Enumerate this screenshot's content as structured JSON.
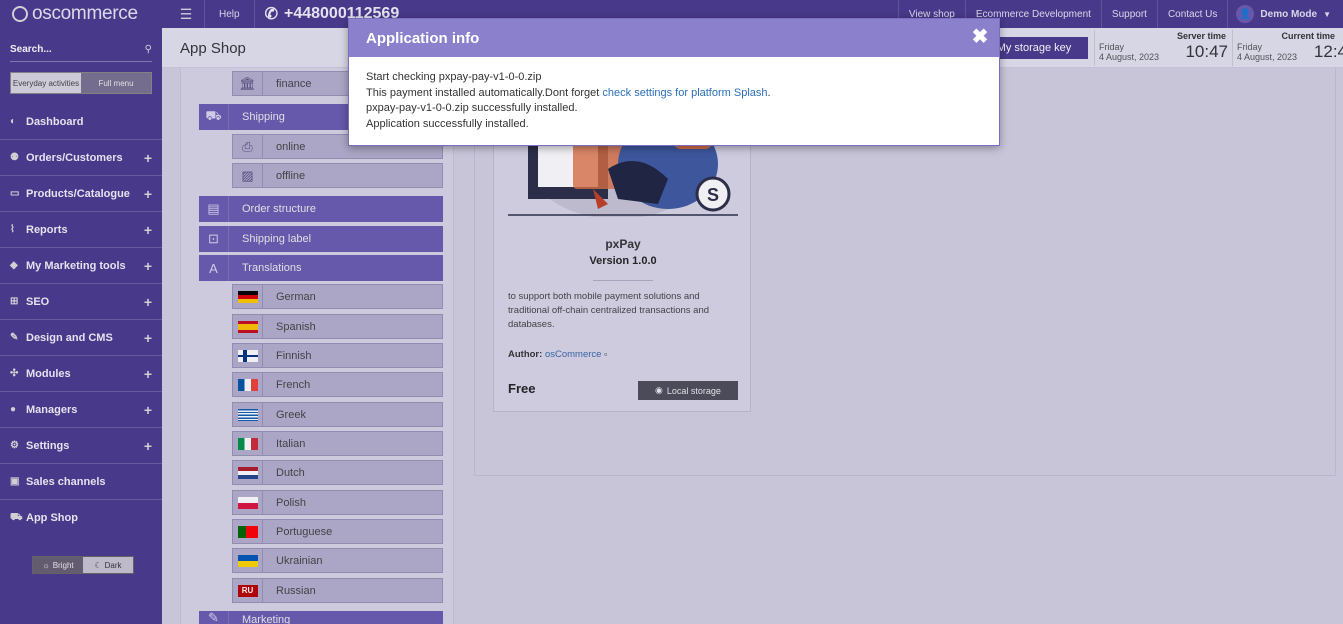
{
  "topbar": {
    "logo": "oscommerce",
    "help": "Help",
    "phone": "+448000112569",
    "links": [
      "View shop",
      "Ecommerce Development",
      "Support",
      "Contact Us"
    ],
    "user": "Demo Mode"
  },
  "sidebar": {
    "search_placeholder": "Search...",
    "toggle": [
      "Everyday activities",
      "Full menu"
    ],
    "items": [
      {
        "label": "Dashboard",
        "icon": "palette-icon",
        "plus": ""
      },
      {
        "label": "Orders/Customers",
        "icon": "users-icon",
        "plus": "+"
      },
      {
        "label": "Products/Catalogue",
        "icon": "folder-icon",
        "plus": "+"
      },
      {
        "label": "Reports",
        "icon": "chart-icon",
        "plus": "+"
      },
      {
        "label": "My Marketing tools",
        "icon": "tag-icon",
        "plus": "+"
      },
      {
        "label": "SEO",
        "icon": "sitemap-icon",
        "plus": "+"
      },
      {
        "label": "Design and CMS",
        "icon": "brush-icon",
        "plus": "+"
      },
      {
        "label": "Modules",
        "icon": "puzzle-icon",
        "plus": "+"
      },
      {
        "label": "Managers",
        "icon": "user-icon",
        "plus": "+"
      },
      {
        "label": "Settings",
        "icon": "gears-icon",
        "plus": "+"
      },
      {
        "label": "Sales channels",
        "icon": "monitor-icon",
        "plus": ""
      },
      {
        "label": "App Shop",
        "icon": "cart-icon",
        "plus": ""
      }
    ],
    "theme": [
      "Bright",
      "Dark"
    ]
  },
  "header": {
    "title": "App Shop",
    "storage_button": "My storage key",
    "server_time": {
      "label": "Server time",
      "day": "Friday",
      "date": "4 August, 2023",
      "time": "10:47"
    },
    "current_time": {
      "label": "Current time",
      "day": "Friday",
      "date": "4 August, 2023",
      "time": "12:4"
    }
  },
  "tree": {
    "finance": "finance",
    "shipping": "Shipping",
    "online": "online",
    "offline": "offline",
    "order_structure": "Order structure",
    "shipping_label": "Shipping label",
    "translations": "Translations",
    "languages": [
      "German",
      "Spanish",
      "Finnish",
      "French",
      "Greek",
      "Italian",
      "Dutch",
      "Polish",
      "Portuguese",
      "Ukrainian",
      "Russian"
    ],
    "ru_badge": "RU",
    "marketing": "Marketing"
  },
  "card": {
    "name": "pxPay",
    "version": "Version 1.0.0",
    "description": "to support both mobile payment solutions and traditional off-chain centralized transactions and databases.",
    "author_label": "Author:",
    "author": "osCommerce",
    "price": "Free",
    "button": "Local storage"
  },
  "modal": {
    "title": "Application info",
    "line1": "Start checking pxpay-pay-v1-0-0.zip",
    "line2_text": "This payment installed automatically.Dont forget ",
    "line2_link": "check settings for platform Splash",
    "line2_end": ".",
    "line3": "pxpay-pay-v1-0-0.zip successfully installed.",
    "line4": "Application successfully installed.",
    "close": "✖"
  }
}
